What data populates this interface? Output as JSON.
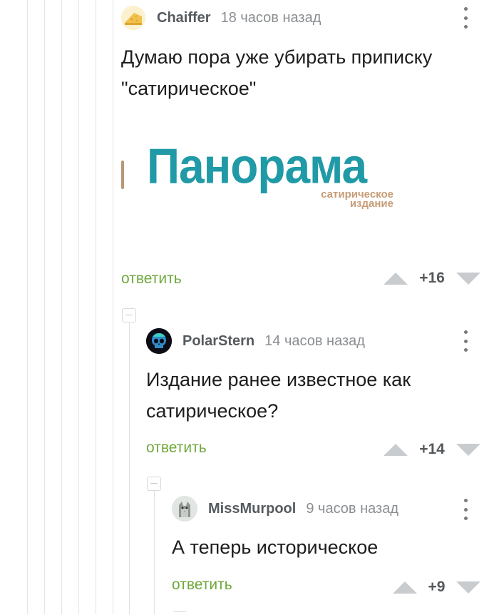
{
  "comments": [
    {
      "author": "Chaiffer",
      "time": "18 часов назад",
      "text_line1": "Думаю пора уже убирать приписку",
      "text_line2": "\"сатирическое\"",
      "reply": "ответить",
      "rating": "+16",
      "image": {
        "logo_text": "Панорама",
        "sub_line1": "сатирическое",
        "sub_line2": "издание"
      }
    },
    {
      "author": "PolarStern",
      "time": "14 часов назад",
      "text_line1": "Издание ранее известное как",
      "text_line2": "сатирическое?",
      "reply": "ответить",
      "rating": "+14"
    },
    {
      "author": "MissMurpool",
      "time": "9 часов назад",
      "text_line1": "А теперь историческое",
      "reply": "ответить",
      "rating": "+9"
    }
  ],
  "colors": {
    "reply_link": "#6fa83c",
    "logo_teal": "#1f9aa6",
    "logo_sub": "#c79b76",
    "vote_arrow": "#c9cccf"
  },
  "icons": {
    "menu": "vertical-ellipsis-icon",
    "upvote": "triangle-up-icon",
    "downvote": "triangle-down-icon",
    "collapse": "minus-box-icon"
  }
}
